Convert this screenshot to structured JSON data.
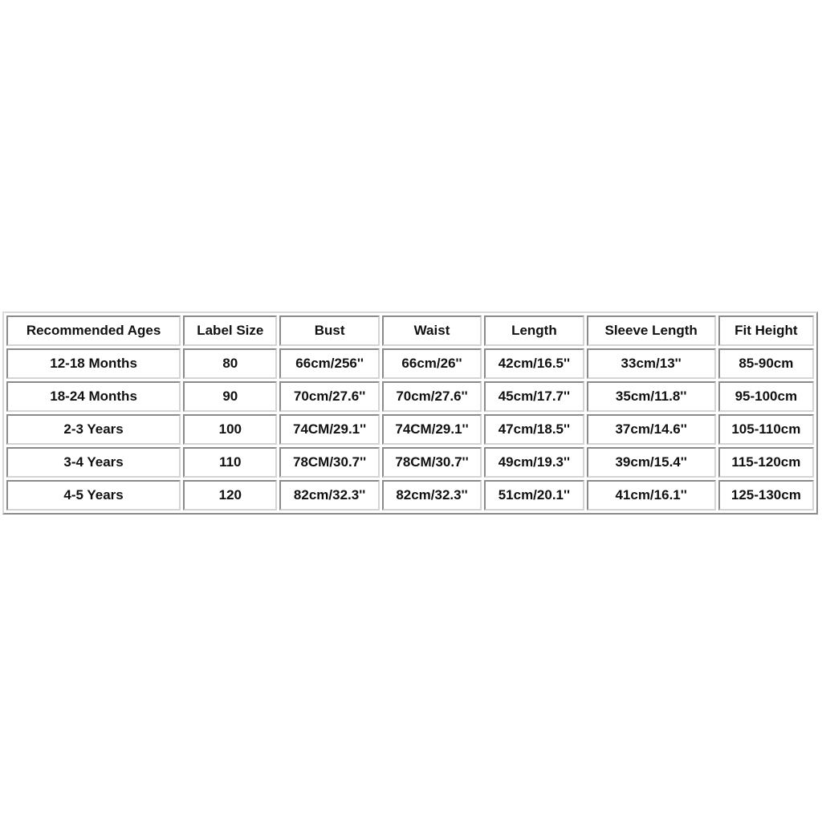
{
  "size_chart": {
    "headers": [
      "Recommended Ages",
      "Label Size",
      "Bust",
      "Waist",
      "Length",
      "Sleeve Length",
      "Fit Height"
    ],
    "rows": [
      [
        "12-18 Months",
        "80",
        "66cm/256''",
        "66cm/26''",
        "42cm/16.5''",
        "33cm/13''",
        "85-90cm"
      ],
      [
        "18-24 Months",
        "90",
        "70cm/27.6''",
        "70cm/27.6''",
        "45cm/17.7''",
        "35cm/11.8''",
        "95-100cm"
      ],
      [
        "2-3 Years",
        "100",
        "74CM/29.1''",
        "74CM/29.1''",
        "47cm/18.5''",
        "37cm/14.6''",
        "105-110cm"
      ],
      [
        "3-4 Years",
        "110",
        "78CM/30.7''",
        "78CM/30.7''",
        "49cm/19.3''",
        "39cm/15.4''",
        "115-120cm"
      ],
      [
        "4-5 Years",
        "120",
        "82cm/32.3''",
        "82cm/32.3''",
        "51cm/20.1''",
        "41cm/16.1''",
        "125-130cm"
      ]
    ]
  }
}
